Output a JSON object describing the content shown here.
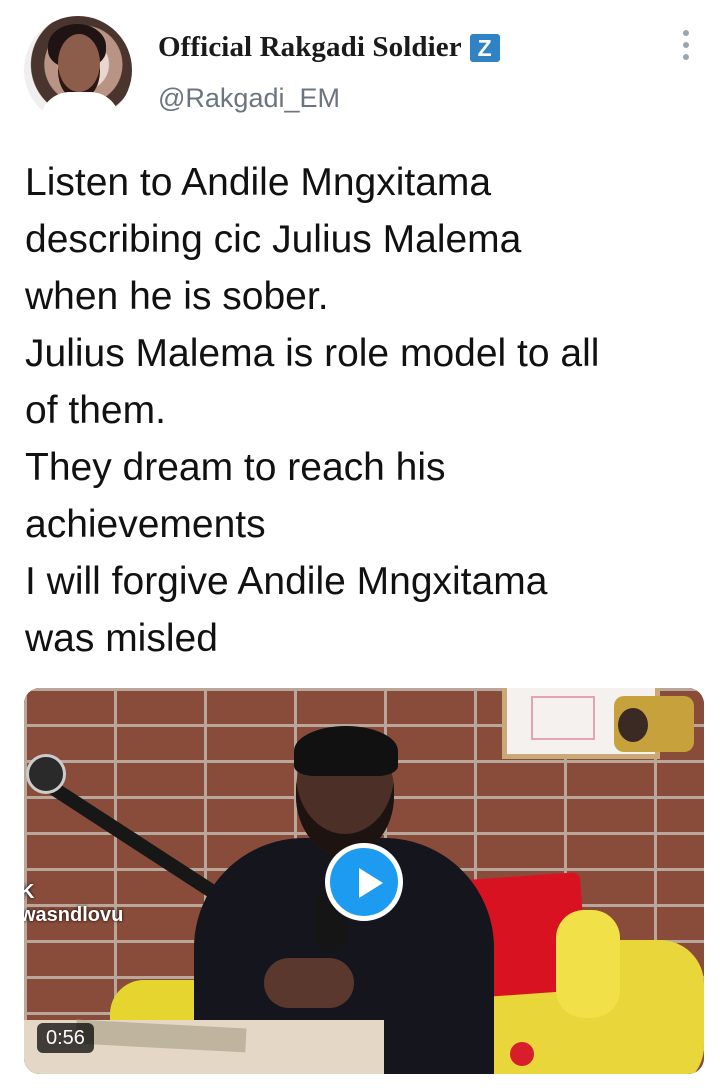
{
  "tweet": {
    "display_name": "Official Rakgadi Soldier",
    "badge_text": "Z",
    "handle": "@Rakgadi_EM",
    "more_icon": "vertical-ellipsis-icon",
    "text_lines": [
      "Listen to Andile Mngxitama",
      "describing cic Julius Malema",
      "when he is sober.",
      "Julius Malema is role model to all",
      "of them.",
      "They dream to reach his",
      "achievements",
      "I will forgive Andile Mngxitama",
      "was misled"
    ]
  },
  "media": {
    "type": "video",
    "watermark_text": "K\nwasndlovu",
    "duration": "0:56",
    "play_icon": "play-icon",
    "accent_color": "#1d9bf0"
  }
}
